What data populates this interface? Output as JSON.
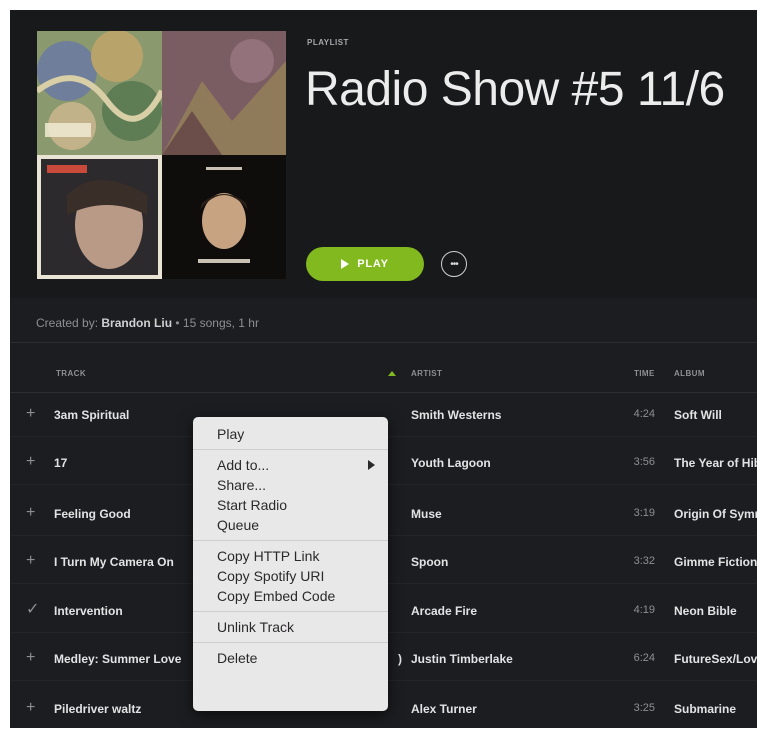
{
  "playlist": {
    "type_label": "PLAYLIST",
    "title": "Radio Show #5 11/6",
    "play_label": "PLAY",
    "more_label": "•••",
    "created_by_label": "Created by:",
    "owner": "Brandon Liu",
    "summary": " • 15 songs, 1 hr"
  },
  "columns": {
    "track": "TRACK",
    "artist": "ARTIST",
    "time": "TIME",
    "album": "ALBUM"
  },
  "tracks": [
    {
      "action": "+",
      "name": "3am Spiritual",
      "artist": "Smith Westerns",
      "time": "4:24",
      "album": "Soft Will"
    },
    {
      "action": "+",
      "name": "17",
      "artist": "Youth Lagoon",
      "time": "3:56",
      "album": "The Year of Hibernation"
    },
    {
      "action": "+",
      "name": "Feeling Good",
      "artist": "Muse",
      "time": "3:19",
      "album": "Origin Of Symmetry"
    },
    {
      "action": "+",
      "name": "I Turn My Camera On",
      "artist": "Spoon",
      "time": "3:32",
      "album": "Gimme Fiction"
    },
    {
      "action": "✓",
      "name": "Intervention",
      "artist": "Arcade Fire",
      "time": "4:19",
      "album": "Neon Bible"
    },
    {
      "action": "+",
      "name": "Medley: Summer Love",
      "name_tail": ")",
      "artist": "Justin Timberlake",
      "time": "6:24",
      "album": "FutureSex/LoveSounds"
    },
    {
      "action": "+",
      "name": "Piledriver waltz",
      "artist": "Alex Turner",
      "time": "3:25",
      "album": "Submarine"
    }
  ],
  "context_menu": {
    "play": "Play",
    "add_to": "Add to...",
    "share": "Share...",
    "start_radio": "Start Radio",
    "queue": "Queue",
    "copy_http_link": "Copy HTTP Link",
    "copy_spotify_uri": "Copy Spotify URI",
    "copy_embed_code": "Copy Embed Code",
    "unlink_track": "Unlink Track",
    "delete": "Delete"
  },
  "colors": {
    "accent": "#82b91e",
    "background": "#1c1d20",
    "menu_bg": "#e9e8e9"
  }
}
